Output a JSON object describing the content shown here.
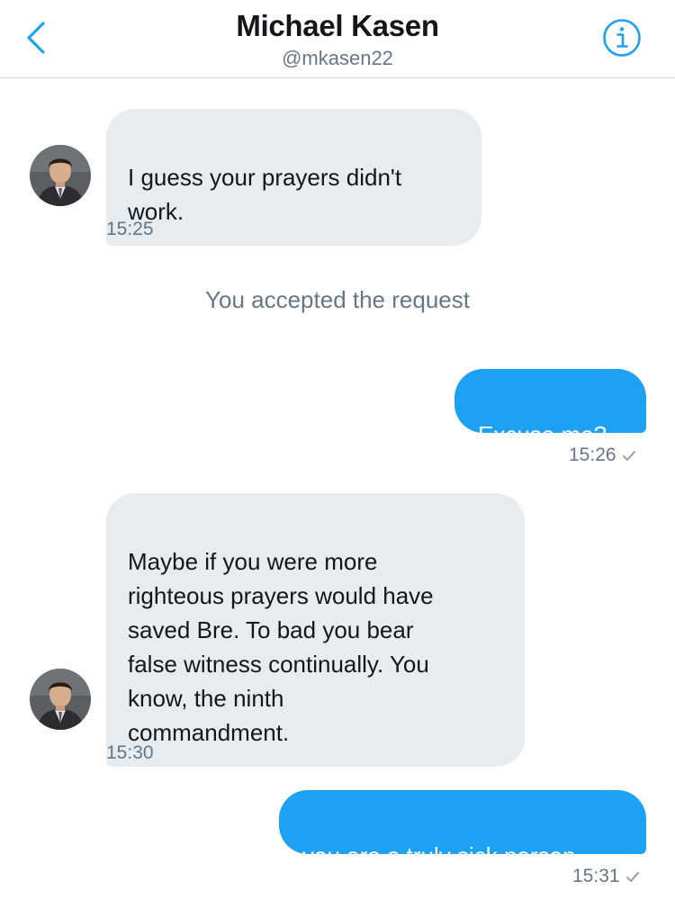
{
  "header": {
    "name": "Michael Kasen",
    "handle": "@mkasen22"
  },
  "colors": {
    "accent": "#1da1f2",
    "incoming_bubble": "#e6ecf0",
    "secondary_text": "#657786"
  },
  "icons": {
    "back": "chevron-left-icon",
    "info": "info-circle-icon",
    "read": "checkmark-icon"
  },
  "messages": [
    {
      "direction": "incoming",
      "text": "I guess your prayers didn't\nwork.",
      "time": "15:25"
    },
    {
      "direction": "system",
      "text": "You accepted the request"
    },
    {
      "direction": "outgoing",
      "text": "Excuse me?",
      "time": "15:26"
    },
    {
      "direction": "incoming",
      "text": "Maybe if you were more\nrighteous  prayers would have\nsaved Bre. To bad you bear\nfalse witness continually. You\nknow, the ninth\ncommandment.",
      "time": "15:30"
    },
    {
      "direction": "outgoing",
      "text": "you are a truly sick person",
      "time": "15:31"
    }
  ]
}
